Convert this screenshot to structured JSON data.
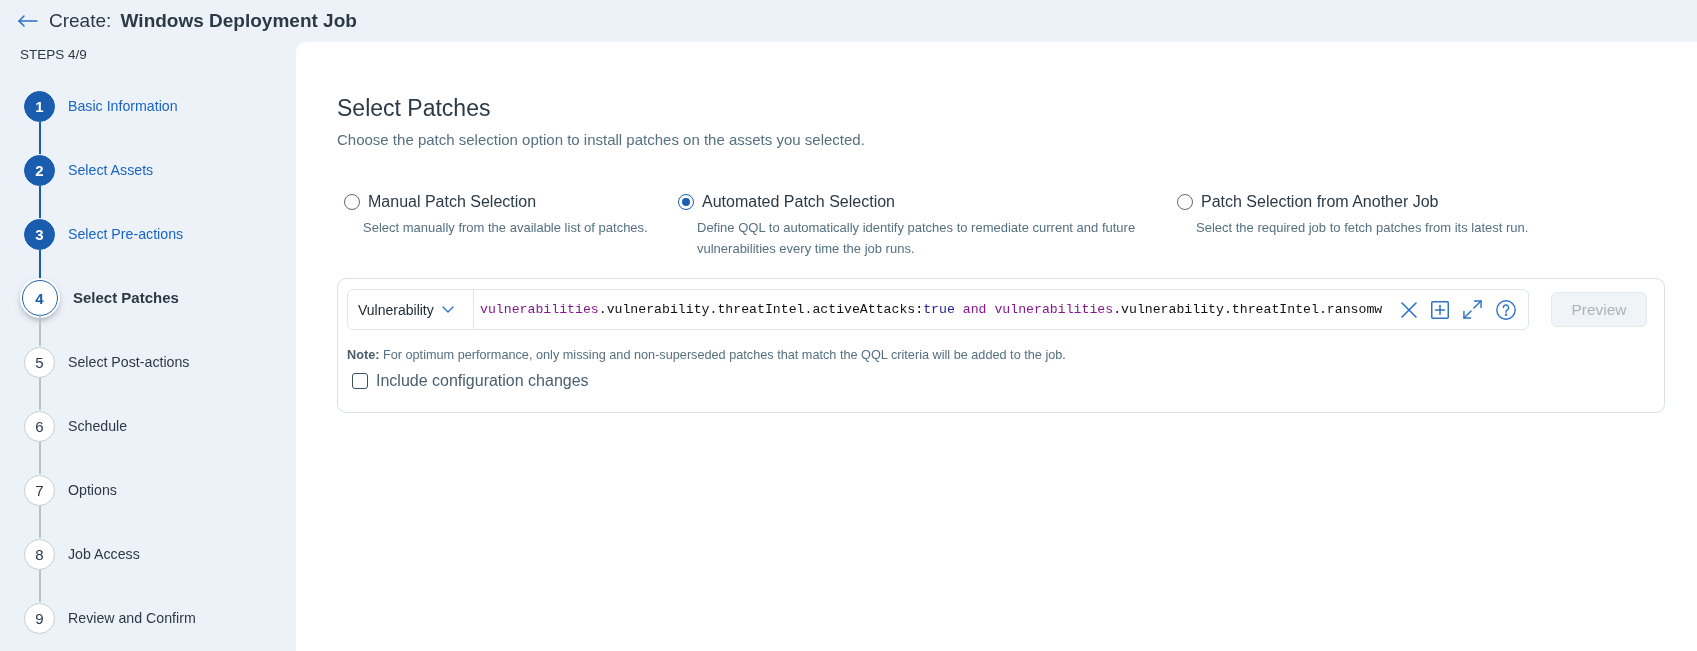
{
  "header": {
    "title": "Create: **Windows Deployment Job**"
  },
  "sidebar": {
    "steps_label": "STEPS 4/9",
    "steps": [
      {
        "number": "1",
        "label": "Basic Information",
        "completed": true,
        "selected": false
      },
      {
        "number": "2",
        "label": "Select Assets",
        "completed": true,
        "selected": false
      },
      {
        "number": "3",
        "label": "Select Pre-actions",
        "completed": true,
        "selected": false
      },
      {
        "number": "4",
        "label": "Select Patches",
        "completed": false,
        "selected": true
      },
      {
        "number": "5",
        "label": "Select Post-actions",
        "completed": false,
        "selected": false
      },
      {
        "number": "6",
        "label": "Schedule",
        "completed": false,
        "selected": false
      },
      {
        "number": "7",
        "label": "Options",
        "completed": false,
        "selected": false
      },
      {
        "number": "8",
        "label": "Job Access",
        "completed": false,
        "selected": false
      },
      {
        "number": "9",
        "label": "Review and Confirm",
        "completed": false,
        "selected": false
      }
    ]
  },
  "content": {
    "title": "Select Patches",
    "description": "Choose the patch selection option to install patches on the assets you selected.",
    "options": [
      {
        "label": "Manual Patch Selection",
        "description": "Select manually from the available list of patches.",
        "selected": false
      },
      {
        "label": "Automated Patch Selection",
        "description": "Define QQL to automatically identify patches to remediate current and future vulnerabilities every time the job runs.",
        "selected": true
      },
      {
        "label": "Patch Selection from Another Job",
        "description": "Select the required job to fetch patches from its latest run.",
        "selected": false
      }
    ],
    "query_panel": {
      "entity": "Vulnerability",
      "tokens": [
        {
          "kind": "field",
          "text": "vulnerabilities"
        },
        {
          "kind": "plain",
          "text": ".vulnerability.threatIntel.activeAttacks:"
        },
        {
          "kind": "value",
          "text": "true"
        },
        {
          "kind": "operator",
          "text": " and "
        },
        {
          "kind": "field",
          "text": "vulnerabilities"
        },
        {
          "kind": "plain",
          "text": ".vulnerability.threatIntel.ransomw"
        }
      ],
      "preview_button": {
        "label": "Preview",
        "disabled": true
      },
      "note": "**Note:** For optimum performance, only missing and non-superseded patches that match the QQL criteria will be added to the job.",
      "include_option": {
        "label": "Include configuration changes",
        "checked": false
      }
    }
  }
}
